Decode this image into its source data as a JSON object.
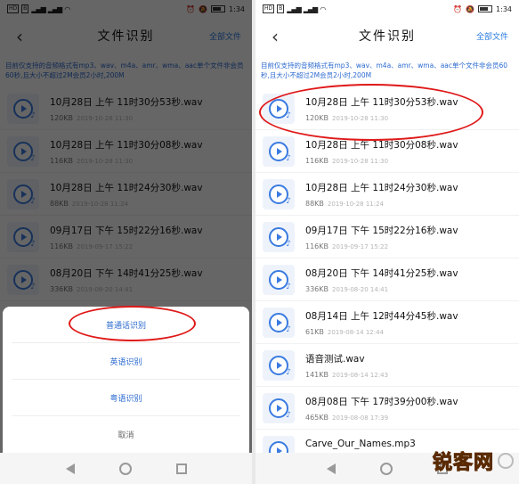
{
  "status": {
    "left_badges": [
      "HD",
      "B",
      "4G",
      "4G"
    ],
    "time": "1:34"
  },
  "nav": {
    "title": "文件识别",
    "action": "全部文件"
  },
  "notice": "目前仅支持的音频格式有mp3、wav、m4a、amr、wma、aac单个文件非会员60秒,且大小不超过2M会员2小时,200M",
  "files": [
    {
      "name": "10月28日 上午 11时30分53秒.wav",
      "size": "120KB",
      "date": "2019-10-28 11:30"
    },
    {
      "name": "10月28日 上午 11时30分08秒.wav",
      "size": "116KB",
      "date": "2019-10-28 11:30"
    },
    {
      "name": "10月28日 上午 11时24分30秒.wav",
      "size": "88KB",
      "date": "2019-10-28 11:24"
    },
    {
      "name": "09月17日 下午 15时22分16秒.wav",
      "size": "116KB",
      "date": "2019-09-17 15:22"
    },
    {
      "name": "08月20日 下午 14时41分25秒.wav",
      "size": "336KB",
      "date": "2019-08-20 14:41"
    },
    {
      "name": "08月14日 上午 12时44分45秒.wav",
      "size": "61KB",
      "date": "2019-08-14 12:44"
    },
    {
      "name": "语音测试.wav",
      "size": "141KB",
      "date": "2019-08-14 12:43"
    },
    {
      "name": "08月08日 下午 17时39分00秒.wav",
      "size": "465KB",
      "date": "2019-08-08 17:39"
    },
    {
      "name": "Carve_Our_Names.mp3",
      "size": "",
      "date": ""
    }
  ],
  "sheet": {
    "options": [
      "普通话识别",
      "英语识别",
      "粤语识别"
    ],
    "cancel": "取消"
  },
  "watermark": "锐客网",
  "colors": {
    "accent": "#2b7be0",
    "annotation": "#e01818"
  }
}
